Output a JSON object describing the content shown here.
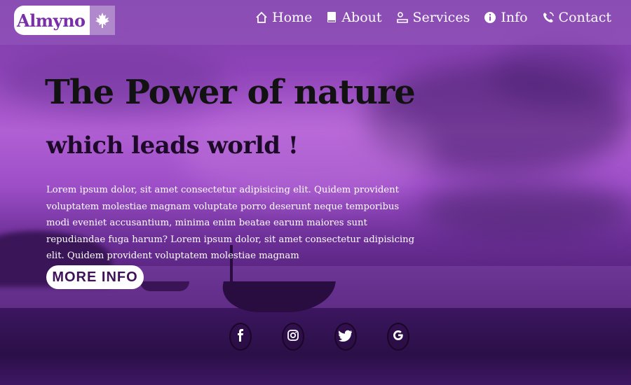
{
  "brand": {
    "name": "Almyno",
    "leaf_icon": "maple-leaf-icon"
  },
  "nav": [
    {
      "label": "Home",
      "icon": "home-icon"
    },
    {
      "label": "About",
      "icon": "book-icon"
    },
    {
      "label": "Services",
      "icon": "services-icon"
    },
    {
      "label": "Info",
      "icon": "info-icon"
    },
    {
      "label": "Contact",
      "icon": "phone-icon"
    }
  ],
  "hero": {
    "title": "The Power of nature",
    "subtitle": "which leads world !",
    "paragraph": "Lorem ipsum dolor, sit amet consectetur adipisicing elit. Quidem provident voluptatem molestiae magnam voluptate porro deserunt neque temporibus modi eveniet accusantium, minima enim beatae earum maiores sunt repudiandae fuga harum? Lorem ipsum dolor, sit amet consectetur adipisicing elit. Quidem provident voluptatem molestiae magnam",
    "button_label": "MORE INFO"
  },
  "social": [
    "facebook-icon",
    "instagram-icon",
    "twitter-icon",
    "google-icon"
  ],
  "colors": {
    "brand_text": "#7a2fa8",
    "title": "#121212",
    "button_text": "#3d1259"
  }
}
